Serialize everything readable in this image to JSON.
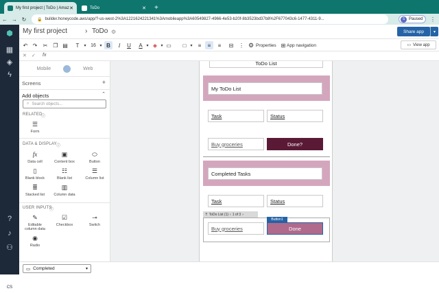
{
  "browser": {
    "tabs": [
      {
        "title": "My first project | ToDo | Amaz",
        "active": true
      },
      {
        "title": "ToDo",
        "active": false
      }
    ],
    "new_tab": "+",
    "url": "builder.honeycode.aws/app/?-us-west-2%3A1221624221341%3Amobileapp%3A60549827-4966-4e53-b20f-8b3523bd37b8%2F677043c6-1477-4311-9...",
    "profile_initial": "S",
    "status": "Paused"
  },
  "header": {
    "project": "My first project",
    "separator": "›",
    "app": "ToDo",
    "share_label": "Share app"
  },
  "toolbar": {
    "font_label": "T",
    "font_size": "16",
    "bold": "B",
    "italic": "I",
    "underline": "U",
    "text_color": "A",
    "properties": "Properties",
    "app_navigation": "App navigation",
    "view_app": "View app"
  },
  "formula": {
    "icon": "fx"
  },
  "panel": {
    "mobile": "Mobile",
    "web": "Web",
    "screens": "Screens",
    "add_objects": "Add objects",
    "search_placeholder": "Search objects...",
    "related": "RELATED",
    "form": "Form",
    "data_display": "DATA & DISPLAY",
    "data_items": [
      "Data cell",
      "Content box",
      "Button",
      "Blank block",
      "Blank list",
      "Column list",
      "Stacked list",
      "Column data"
    ],
    "user_inputs": "USER INPUTS",
    "input_items": [
      "Editable column data",
      "Checkbox",
      "Switch",
      "Radio"
    ]
  },
  "phone": {
    "top_title": "ToDo List",
    "list_title": "My ToDo List",
    "col_task": "Task",
    "col_status": "Status",
    "item_task": "Buy groceries",
    "item_button": "Done?",
    "completed_title": "Completed Tasks",
    "list_bar": "ToDo List (1)",
    "pager": "1 of 3",
    "button_tag": "Button1",
    "done_button": "Done"
  },
  "bottom": {
    "screen_select": "Completed"
  },
  "colors": {
    "accent": "#2563a6",
    "pink": "#d4a6be",
    "dark_button": "#5a1a36",
    "done_button": "#b06a8c",
    "rail": "#1d2939"
  }
}
